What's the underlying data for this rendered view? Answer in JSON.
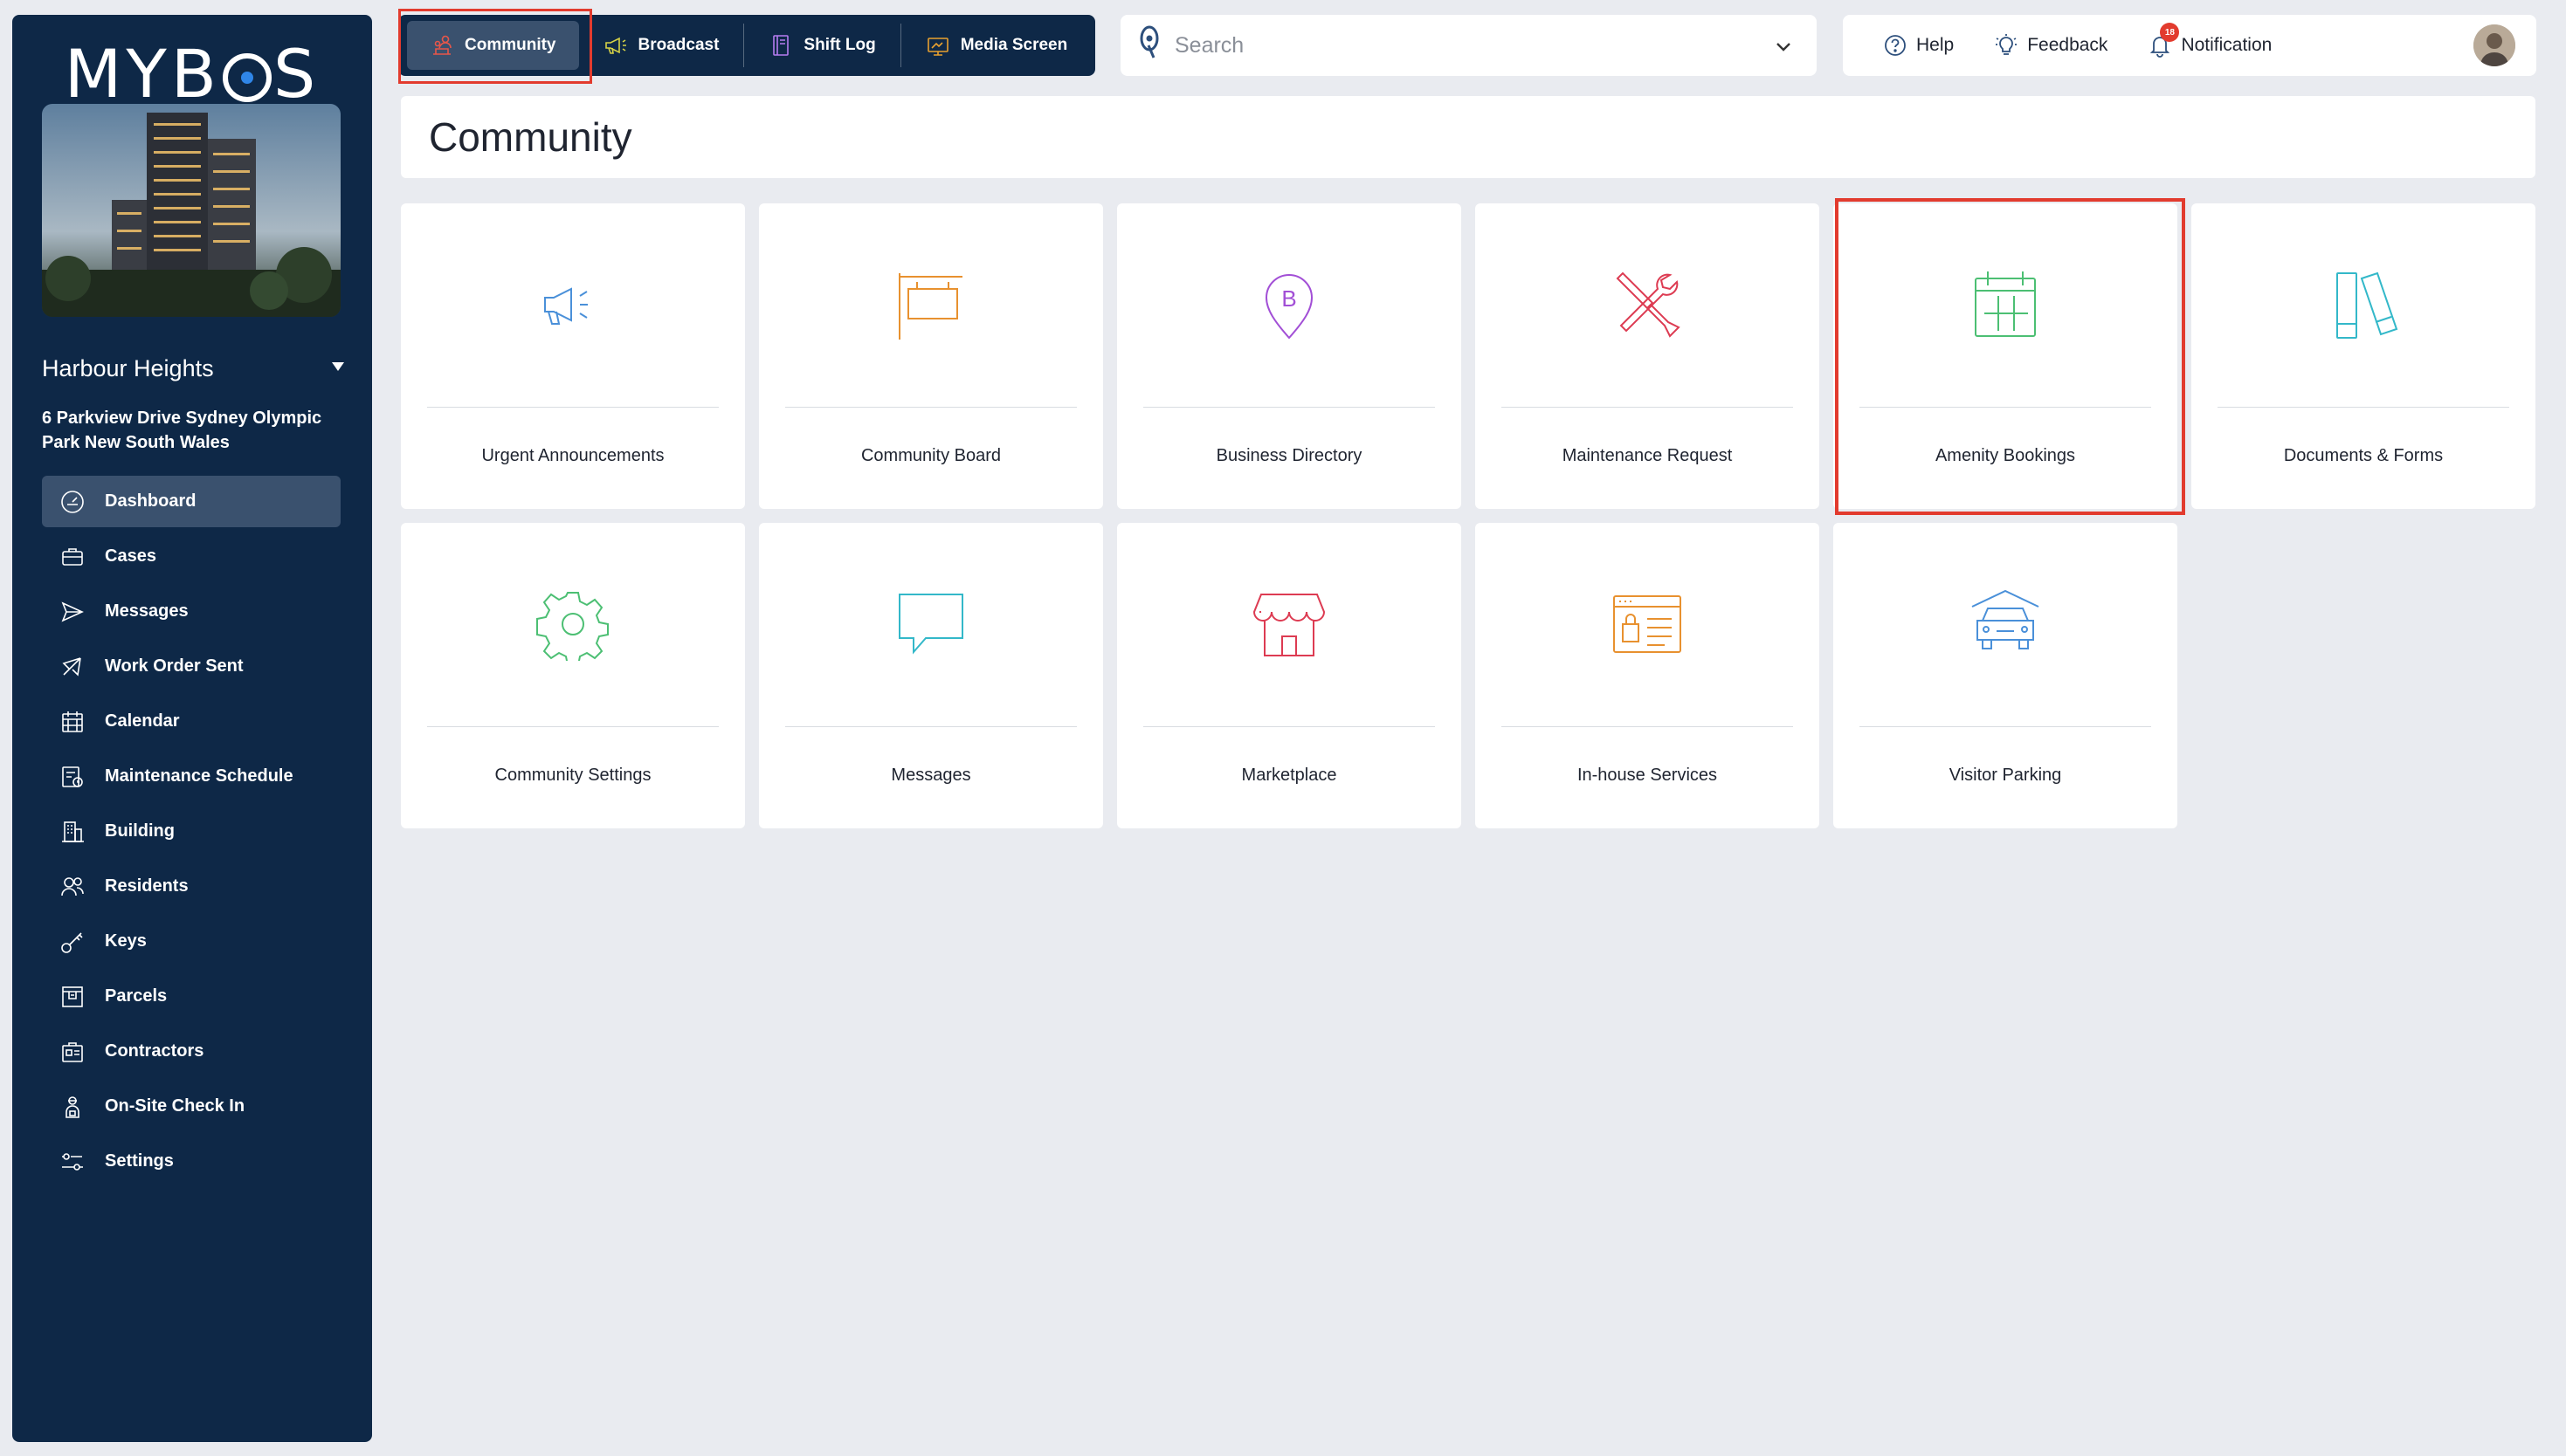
{
  "brand": {
    "logo_text_left": "MYB",
    "logo_text_right": "S"
  },
  "site": {
    "name": "Harbour Heights",
    "address": "6 Parkview Drive Sydney Olympic Park New South Wales"
  },
  "sidebar": {
    "items": [
      {
        "label": "Dashboard",
        "icon": "dashboard-icon",
        "active": true
      },
      {
        "label": "Cases",
        "icon": "briefcase-icon"
      },
      {
        "label": "Messages",
        "icon": "send-icon"
      },
      {
        "label": "Work Order Sent",
        "icon": "megaphone-icon"
      },
      {
        "label": "Calendar",
        "icon": "calendar-icon"
      },
      {
        "label": "Maintenance Schedule",
        "icon": "schedule-icon"
      },
      {
        "label": "Building",
        "icon": "building-icon"
      },
      {
        "label": "Residents",
        "icon": "residents-icon"
      },
      {
        "label": "Keys",
        "icon": "key-icon"
      },
      {
        "label": "Parcels",
        "icon": "parcel-icon"
      },
      {
        "label": "Contractors",
        "icon": "contractor-icon"
      },
      {
        "label": "On-Site Check In",
        "icon": "check-in-icon"
      },
      {
        "label": "Settings",
        "icon": "settings-icon"
      }
    ]
  },
  "tabs": [
    {
      "label": "Community",
      "icon": "community-icon",
      "active": true
    },
    {
      "label": "Broadcast",
      "icon": "broadcast-icon"
    },
    {
      "label": "Shift Log",
      "icon": "shift-log-icon"
    },
    {
      "label": "Media Screen",
      "icon": "media-screen-icon"
    }
  ],
  "search": {
    "placeholder": "Search"
  },
  "toolbar": {
    "help": "Help",
    "feedback": "Feedback",
    "notification": "Notification",
    "notification_count": "18"
  },
  "page": {
    "title": "Community"
  },
  "tiles": [
    {
      "label": "Urgent Announcements",
      "icon": "megaphone-icon",
      "color": "#4a90d9"
    },
    {
      "label": "Community Board",
      "icon": "board-icon",
      "color": "#e8912f"
    },
    {
      "label": "Business Directory",
      "icon": "location-b-icon",
      "color": "#a24fd6"
    },
    {
      "label": "Maintenance Request",
      "icon": "tools-icon",
      "color": "#dd3b52"
    },
    {
      "label": "Amenity Bookings",
      "icon": "calendar-icon",
      "color": "#4cbf73",
      "highlighted": true
    },
    {
      "label": "Documents & Forms",
      "icon": "documents-icon",
      "color": "#33b8c9"
    },
    {
      "label": "Community Settings",
      "icon": "gear-icon",
      "color": "#4cbf73"
    },
    {
      "label": "Messages",
      "icon": "chat-icon",
      "color": "#33b8c9"
    },
    {
      "label": "Marketplace",
      "icon": "store-icon",
      "color": "#dd3b52"
    },
    {
      "label": "In-house Services",
      "icon": "services-icon",
      "color": "#e8912f"
    },
    {
      "label": "Visitor Parking",
      "icon": "car-icon",
      "color": "#4a90d9"
    }
  ],
  "colors": {
    "sidebar_bg": "#0e2847",
    "active_bg": "#3a516e",
    "highlight": "#e23b2e",
    "page_bg": "#e9ebf0"
  }
}
